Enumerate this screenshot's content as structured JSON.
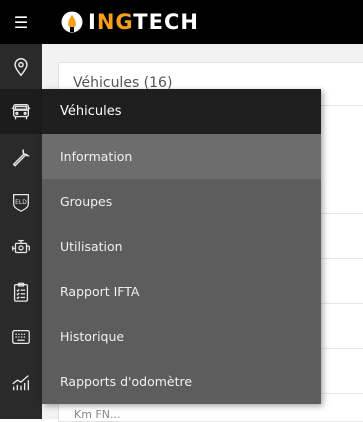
{
  "topbar": {
    "menu_icon": "hamburger-icon",
    "logo": {
      "prefix": "I",
      "accent": "NG",
      "suffix": "TECH"
    }
  },
  "sidebar": {
    "items": [
      {
        "icon": "location-pin-icon"
      },
      {
        "icon": "truck-icon"
      },
      {
        "icon": "wrench-icon"
      },
      {
        "icon": "eld-badge-icon"
      },
      {
        "icon": "engine-icon"
      },
      {
        "icon": "clipboard-checklist-icon"
      },
      {
        "icon": "keyboard-icon"
      },
      {
        "icon": "bar-chart-icon"
      }
    ]
  },
  "main": {
    "card_title": "Véhicules (16)",
    "peek_text": "Km FN..."
  },
  "menu": {
    "header": "Véhicules",
    "items": [
      {
        "label": "Information"
      },
      {
        "label": "Groupes"
      },
      {
        "label": "Utilisation"
      },
      {
        "label": "Rapport IFTA"
      },
      {
        "label": "Historique"
      },
      {
        "label": "Rapports d'odomètre"
      }
    ]
  },
  "colors": {
    "accent": "#f5a11a",
    "topbar": "#000000",
    "sidebar": "#2a2a2a",
    "menu_bg": "#5d5d5d",
    "menu_header": "#1f1f1f",
    "menu_highlight": "#6d6d6d"
  }
}
